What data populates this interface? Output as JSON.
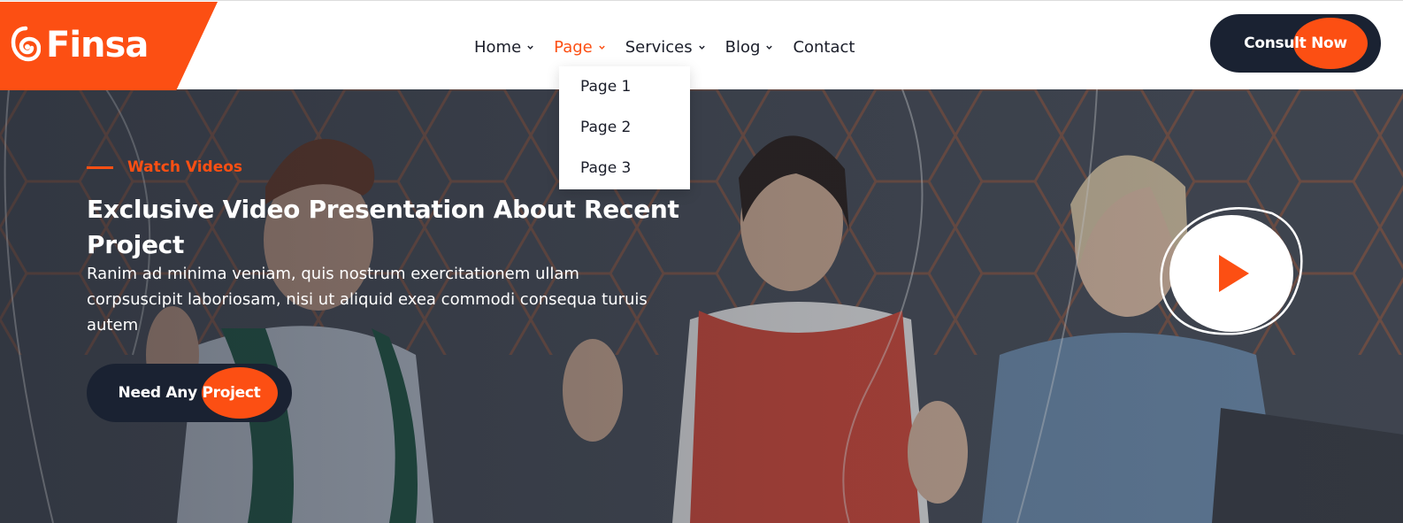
{
  "brand": {
    "name": "Finsa",
    "logo_icon": "finsa-swirl-icon",
    "accent_color": "#fc4f13",
    "dark_color": "#1a2232"
  },
  "nav": {
    "items": [
      {
        "label": "Home",
        "has_dropdown": true
      },
      {
        "label": "Page",
        "has_dropdown": true,
        "active": true
      },
      {
        "label": "Services",
        "has_dropdown": true
      },
      {
        "label": "Blog",
        "has_dropdown": true
      },
      {
        "label": "Contact",
        "has_dropdown": false
      }
    ],
    "dropdown": {
      "parent": "Page",
      "items": [
        "Page 1",
        "Page 2",
        "Page 3"
      ]
    }
  },
  "header": {
    "cta_label": "Consult Now"
  },
  "hero": {
    "eyebrow": "Watch Videos",
    "title": "Exclusive Video Presentation About Recent Project",
    "description": "Ranim ad minima veniam, quis nostrum exercitationem ullam corpsuscipit laboriosam, nisi ut aliquid exea commodi consequa turuis autem",
    "cta_label": "Need Any Project",
    "play_icon": "play-icon"
  }
}
